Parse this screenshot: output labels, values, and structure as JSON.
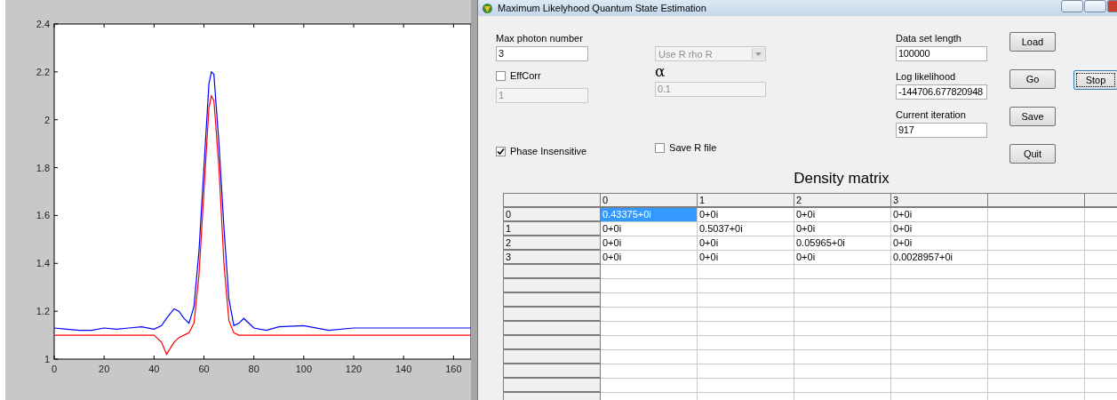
{
  "plot": {
    "chart_data": {
      "type": "line",
      "x": [
        0,
        5,
        10,
        15,
        20,
        25,
        30,
        35,
        40,
        43,
        45,
        48,
        50,
        52,
        54,
        56,
        58,
        60,
        62,
        63,
        64,
        66,
        68,
        70,
        72,
        74,
        76,
        80,
        85,
        90,
        100,
        110,
        120,
        130,
        140,
        150,
        160,
        167
      ],
      "xlim": [
        0,
        167
      ],
      "ylim": [
        1,
        2.4
      ],
      "xticks": [
        0,
        20,
        40,
        60,
        80,
        100,
        120,
        140,
        160
      ],
      "yticks": [
        1,
        1.2,
        1.4,
        1.6,
        1.8,
        2,
        2.2,
        2.4
      ],
      "series": [
        {
          "color": "#0000ff",
          "values": [
            1.13,
            1.125,
            1.12,
            1.12,
            1.13,
            1.125,
            1.13,
            1.135,
            1.125,
            1.14,
            1.17,
            1.21,
            1.2,
            1.17,
            1.15,
            1.22,
            1.45,
            1.8,
            2.15,
            2.2,
            2.19,
            1.9,
            1.55,
            1.25,
            1.14,
            1.15,
            1.17,
            1.13,
            1.12,
            1.135,
            1.14,
            1.12,
            1.13,
            1.13,
            1.13,
            1.13,
            1.13,
            1.13
          ]
        },
        {
          "color": "#ff0000",
          "values": [
            1.1,
            1.1,
            1.1,
            1.1,
            1.1,
            1.1,
            1.1,
            1.1,
            1.1,
            1.07,
            1.02,
            1.07,
            1.09,
            1.1,
            1.11,
            1.15,
            1.35,
            1.7,
            2.05,
            2.1,
            2.08,
            1.8,
            1.4,
            1.16,
            1.11,
            1.1,
            1.1,
            1.1,
            1.1,
            1.1,
            1.1,
            1.1,
            1.1,
            1.1,
            1.1,
            1.1,
            1.1,
            1.1
          ]
        }
      ]
    }
  },
  "window": {
    "title": "Maximum Likelyhood Quantum State Estimation"
  },
  "max_photon": {
    "label": "Max photon number",
    "value": "3"
  },
  "eff_corr": {
    "label": "EffCorr",
    "checked": false
  },
  "eff_corr_field": {
    "value": "1",
    "disabled": true
  },
  "method": {
    "value": "Use R rho R",
    "disabled": true
  },
  "alpha": {
    "label": "α",
    "value": "0.1",
    "disabled": true
  },
  "phase_insensitive": {
    "label": "Phase Insensitive",
    "checked": true
  },
  "save_r_file": {
    "label": "Save R file",
    "checked": false
  },
  "data_set_length": {
    "label": "Data set length",
    "value": "100000"
  },
  "log_likelihood": {
    "label": "Log likelihood",
    "value": "-144706.677820948"
  },
  "current_iteration": {
    "label": "Current iteration",
    "value": "917"
  },
  "buttons": [
    {
      "label": "Load",
      "focused": false
    },
    {
      "label": "Go",
      "focused": false
    },
    {
      "label": "Save",
      "focused": false
    },
    {
      "label": "Quit",
      "focused": false
    }
  ],
  "stop_button": {
    "label": "Stop",
    "focused": true
  },
  "matrix": {
    "title": "Density matrix",
    "columns": [
      "0",
      "1",
      "2",
      "3"
    ],
    "rows": [
      {
        "header": "0",
        "cells": [
          {
            "text": "0.43375+0i",
            "selected": true
          },
          {
            "text": "0+0i",
            "selected": false
          },
          {
            "text": "0+0i",
            "selected": false
          },
          {
            "text": "0+0i",
            "selected": false
          }
        ]
      },
      {
        "header": "1",
        "cells": [
          {
            "text": "0+0i",
            "selected": false
          },
          {
            "text": "0.5037+0i",
            "selected": false
          },
          {
            "text": "0+0i",
            "selected": false
          },
          {
            "text": "0+0i",
            "selected": false
          }
        ]
      },
      {
        "header": "2",
        "cells": [
          {
            "text": "0+0i",
            "selected": false
          },
          {
            "text": "0+0i",
            "selected": false
          },
          {
            "text": "0.05965+0i",
            "selected": false
          },
          {
            "text": "0+0i",
            "selected": false
          }
        ]
      },
      {
        "header": "3",
        "cells": [
          {
            "text": "0+0i",
            "selected": false
          },
          {
            "text": "0+0i",
            "selected": false
          },
          {
            "text": "0+0i",
            "selected": false
          },
          {
            "text": "0.0028957+0i",
            "selected": false
          }
        ]
      }
    ]
  }
}
